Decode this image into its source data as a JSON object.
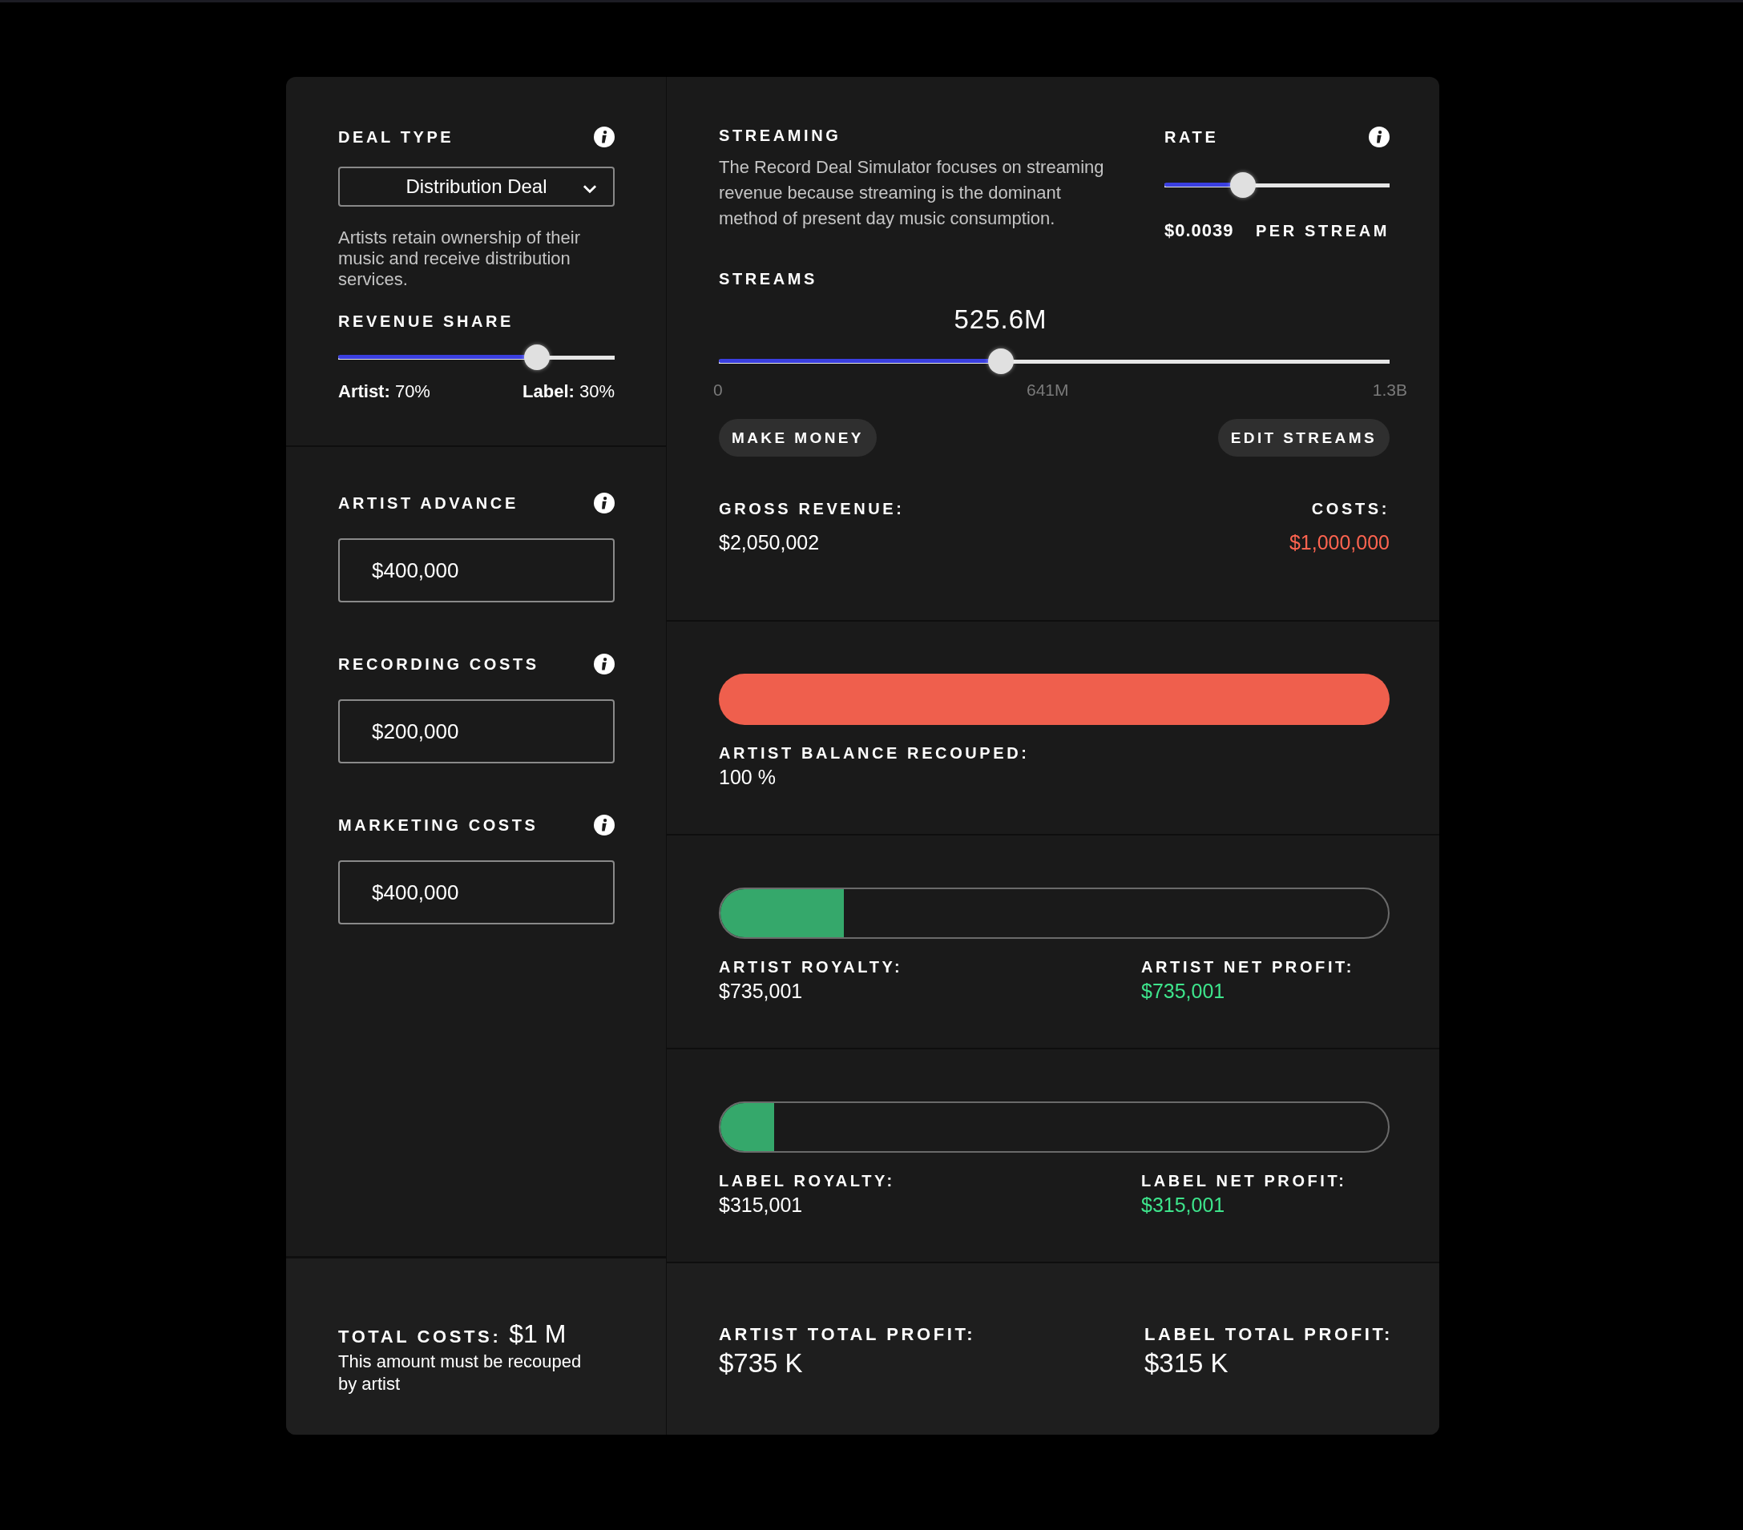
{
  "deal_type": {
    "label": "DEAL TYPE",
    "value": "Distribution Deal",
    "description": "Artists retain ownership of their music and receive distribution services."
  },
  "revenue_share": {
    "label": "REVENUE SHARE",
    "level": 0.72,
    "artist_label": "Artist:",
    "artist_value": "70%",
    "label_label": "Label:",
    "label_value": "30%"
  },
  "cost_inputs": [
    {
      "label": "ARTIST ADVANCE",
      "value": "$400,000"
    },
    {
      "label": "RECORDING COSTS",
      "value": "$200,000"
    },
    {
      "label": "MARKETING COSTS",
      "value": "$400,000"
    }
  ],
  "total_costs": {
    "label": "TOTAL COSTS:",
    "value": "$1 M",
    "note": "This amount must be recouped by artist"
  },
  "streaming": {
    "title": "STREAMING",
    "description": "The Record Deal Simulator focuses on streaming revenue because streaming is the dominant method of present day music consumption."
  },
  "rate": {
    "label": "RATE",
    "level": 0.35,
    "value": "$0.0039",
    "unit": "PER STREAM"
  },
  "streams": {
    "label": "STREAMS",
    "value": "525.6M",
    "level": 0.42,
    "ticks": [
      "0",
      "641M",
      "1.3B"
    ]
  },
  "buttons": [
    "MAKE MONEY",
    "EDIT STREAMS"
  ],
  "gross_revenue": {
    "label": "GROSS REVENUE:",
    "value": "$2,050,002"
  },
  "costs": {
    "label": "COSTS:",
    "value": "$1,000,000"
  },
  "recoup": {
    "level": 1,
    "color": "#ef5f4d",
    "label": "ARTIST BALANCE RECOUPED:",
    "value": "100 %"
  },
  "profit_bars": [
    {
      "level": 0.185,
      "color": "#35a86b",
      "royalty_label": "ARTIST ROYALTY:",
      "royalty_value": "$735,001",
      "net_label": "ARTIST NET PROFIT:",
      "net_value": "$735,001"
    },
    {
      "level": 0.08,
      "color": "#35a86b",
      "royalty_label": "LABEL ROYALTY:",
      "royalty_value": "$315,001",
      "net_label": "LABEL NET PROFIT:",
      "net_value": "$315,001"
    }
  ],
  "totals": [
    {
      "label": "ARTIST TOTAL PROFIT:",
      "value": "$735 K"
    },
    {
      "label": "LABEL TOTAL PROFIT:",
      "value": "$315 K"
    }
  ]
}
